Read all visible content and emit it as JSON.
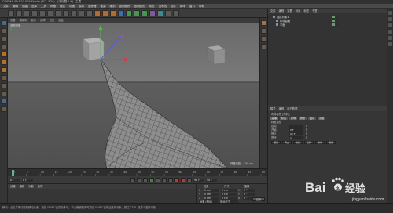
{
  "app": {
    "title": "CINEMA 4D R20.059 Studio (RC - R20) - [未标题 1 *] - 主要"
  },
  "menu": [
    "文件",
    "编辑",
    "创建",
    "选择",
    "工具",
    "网格",
    "捕捉",
    "动画",
    "模拟",
    "追踪器",
    "渲染",
    "雕刻",
    "运动跟踪",
    "运动图形",
    "角色",
    "流水线",
    "插件",
    "脚本",
    "窗口",
    "帮助"
  ],
  "viewport": {
    "menu": [
      "查看",
      "摄像机",
      "显示",
      "选项",
      "过滤",
      "面板"
    ],
    "label": "透视视图",
    "grid_label": "网格间距：100 cm",
    "accent_colors": {
      "x_axis": "#e33",
      "y_axis": "#3c3",
      "z_axis": "#55f"
    }
  },
  "timeline": {
    "ticks": [
      "0",
      "5",
      "10",
      "15",
      "20",
      "25",
      "30",
      "35",
      "40",
      "45",
      "50",
      "55",
      "60",
      "65",
      "70",
      "75",
      "80",
      "85",
      "90"
    ],
    "end_label": "90 F"
  },
  "transport": {
    "start_frame": "0 F",
    "current_frame": "0 F",
    "end_frame": "90 F",
    "max_frame": "90 F"
  },
  "materials": {
    "menu": [
      "创建",
      "编辑",
      "功能",
      "纹理"
    ]
  },
  "coordinates": {
    "headers": [
      "位置",
      "尺寸",
      "旋转"
    ],
    "rows": [
      {
        "axis": "X",
        "pos": "0 cm",
        "size": "0 cm",
        "rot_label": "H",
        "rot": "0 °"
      },
      {
        "axis": "Y",
        "pos": "0 cm",
        "size": "0 cm",
        "rot_label": "P",
        "rot": "0 °"
      },
      {
        "axis": "Z",
        "pos": "0 cm",
        "size": "0 cm",
        "rot_label": "B",
        "rot": "0 °"
      }
    ],
    "mode": "对象 (相对)",
    "size_mode": "绝对尺寸",
    "apply": "应用"
  },
  "object_manager": {
    "menu": [
      "文件",
      "编辑",
      "查看",
      "对象",
      "标签",
      "书签"
    ],
    "objects": [
      {
        "name": "连接对象.1"
      },
      {
        "name": "布料曲面"
      },
      {
        "name": "平面"
      }
    ]
  },
  "attribute_manager": {
    "menu": [
      "模式",
      "编辑",
      "用户数据"
    ],
    "title": "布料标签 [布料]",
    "tabs": [
      "基本",
      "标签",
      "影响",
      "修整",
      "缓存",
      "高级"
    ],
    "section": "标签属性",
    "rows": [
      {
        "label": "自动",
        "value": ""
      },
      {
        "label": "开始",
        "value": "0 F"
      },
      {
        "label": "停止",
        "value": "90 F"
      },
      {
        "label": "迭代",
        "value": "1"
      }
    ],
    "buttons": [
      "硬度",
      "弯曲",
      "橡皮",
      "反弹",
      "摩擦",
      "质量"
    ]
  },
  "status": {
    "text": "移动：点击并拖动鼠标移动元素。按住 SHIFT 键量化移动；节点编辑模式时按住 SHIFT 键增加选择对象；按住 CTRL 键减少选择对象。"
  },
  "watermark": {
    "brand": "Bai",
    "brand2": "经验",
    "url": "jingyan.baidu.com"
  }
}
